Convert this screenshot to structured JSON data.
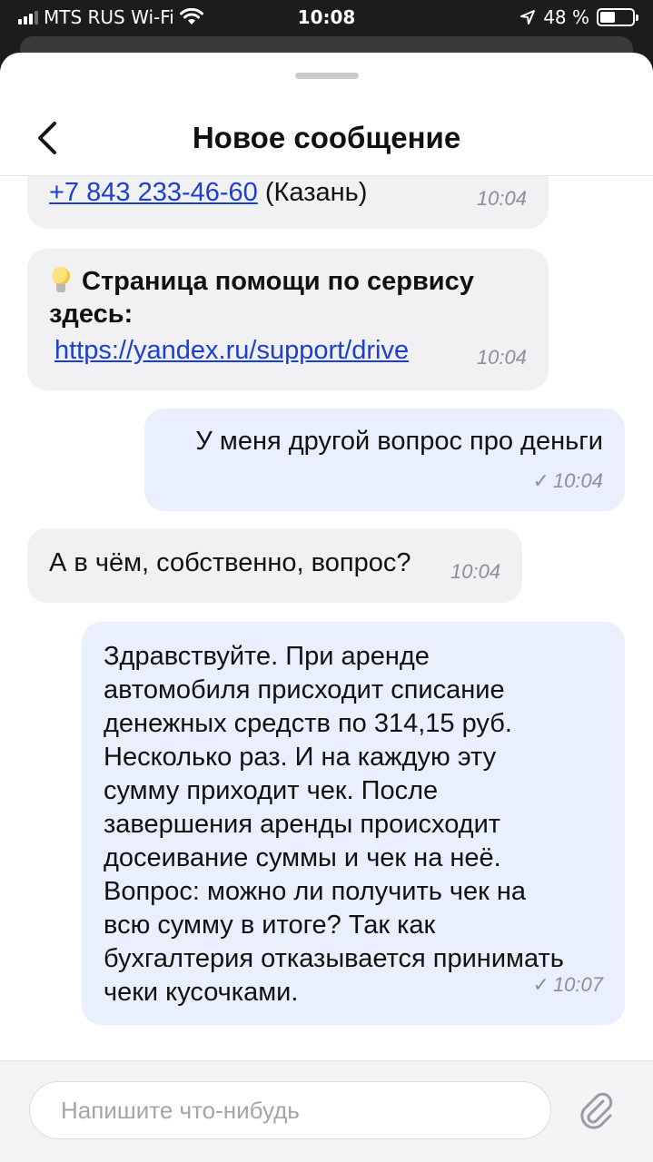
{
  "status_bar": {
    "carrier": "MTS RUS Wi-Fi",
    "time": "10:08",
    "battery": "48 %",
    "battery_level": 0.48
  },
  "header": {
    "title": "Новое сообщение"
  },
  "messages": [
    {
      "direction": "incoming",
      "phone": "+7 843 233-46-60",
      "location": "(Казань)",
      "time": "10:04"
    },
    {
      "direction": "incoming",
      "heading": "Страница помощи по сервису здесь:",
      "url": "https://yandex.ru/support/drive",
      "time": "10:04"
    },
    {
      "direction": "outgoing",
      "text": "У меня другой вопрос про деньги",
      "time": "10:04"
    },
    {
      "direction": "incoming",
      "text": "А в чём, собственно, вопрос?",
      "time": "10:04"
    },
    {
      "direction": "outgoing",
      "text": "Здравствуйте. При аренде\nавтомобиля присходит списание\nденежных средств по 314,15 руб.\nНесколько раз. И на каждую эту\nсумму приходит чек. После\nзавершения аренды происходит\nдосеивание суммы и чек на неё.\nВопрос: можно ли получить чек на\nвсю сумму в итоге? Так как\nбухгалтерия отказывается принимать\nчеки кусочками.",
      "time": "10:07"
    }
  ],
  "composer": {
    "placeholder": "Напишите что-нибудь"
  },
  "icons": {
    "back": "chevron-left-icon",
    "attach": "paperclip-icon",
    "bulb": "lightbulb-icon",
    "sent": "checkmark-icon"
  }
}
